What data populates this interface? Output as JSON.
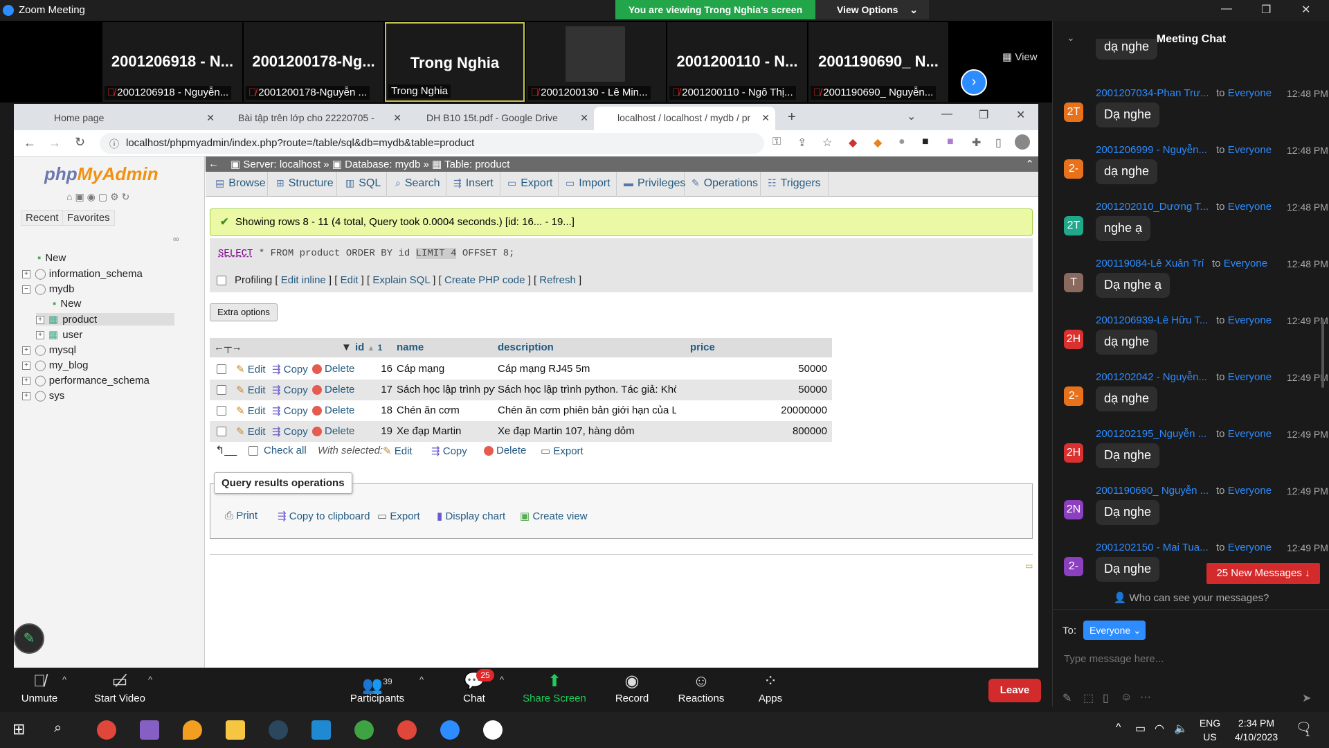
{
  "zoom": {
    "app_title": "Zoom Meeting",
    "viewing_banner": "You are viewing Trong Nghia's screen",
    "view_options": "View Options",
    "view_label": "View",
    "tiles": [
      {
        "big": "2001206918 - N...",
        "label": "2001206918 - Nguyễn..."
      },
      {
        "big": "2001200178-Ng...",
        "label": "2001200178-Nguyễn ..."
      },
      {
        "big": "Trong Nghia",
        "label": "Trong Nghia"
      },
      {
        "big": "",
        "label": "2001200130 - Lê Min..."
      },
      {
        "big": "2001200110 - N...",
        "label": "2001200110 - Ngô Thị..."
      },
      {
        "big": "2001190690_ N...",
        "label": "2001190690_ Nguyễn..."
      }
    ]
  },
  "browser": {
    "tabs": [
      {
        "title": "Home page"
      },
      {
        "title": "Bài tập trên lớp cho 22220705 - "
      },
      {
        "title": "DH B10 15t.pdf - Google Drive"
      },
      {
        "title": "localhost / localhost / mydb / pr"
      }
    ],
    "url": "localhost/phpmyadmin/index.php?route=/table/sql&db=mydb&table=product"
  },
  "pma": {
    "nav_tabs": [
      "Recent",
      "Favorites"
    ],
    "tree": [
      {
        "label": "New",
        "indent": 0
      },
      {
        "label": "information_schema",
        "indent": 0
      },
      {
        "label": "mydb",
        "indent": 0
      },
      {
        "label": "New",
        "indent": 1
      },
      {
        "label": "product",
        "indent": 1
      },
      {
        "label": "user",
        "indent": 1
      },
      {
        "label": "mysql",
        "indent": 0
      },
      {
        "label": "my_blog",
        "indent": 0
      },
      {
        "label": "performance_schema",
        "indent": 0
      },
      {
        "label": "sys",
        "indent": 0
      }
    ],
    "breadcrumb": {
      "server": "Server: localhost",
      "database": "Database: mydb",
      "table": "Table: product"
    },
    "menu": [
      "Browse",
      "Structure",
      "SQL",
      "Search",
      "Insert",
      "Export",
      "Import",
      "Privileges",
      "Operations",
      "Triggers"
    ],
    "success_message": "Showing rows 8 - 11 (4 total, Query took 0.0004 seconds.) [id: 16... - 19...]",
    "sql": {
      "select": "SELECT",
      "rest": " * FROM product ORDER BY id ",
      "limit": "LIMIT 4",
      "offset": " OFFSET 8;"
    },
    "profiling": {
      "label": "Profiling",
      "links": [
        "Edit inline",
        "Edit",
        "Explain SQL",
        "Create PHP code",
        "Refresh"
      ]
    },
    "extra_options": "Extra options",
    "columns": {
      "id": "id",
      "sort_num": "1",
      "name": "name",
      "description": "description",
      "price": "price"
    },
    "row_actions": {
      "edit": "Edit",
      "copy": "Copy",
      "delete": "Delete"
    },
    "rows": [
      {
        "id": "16",
        "name": "Cáp mạng",
        "description": "Cáp mạng RJ45 5m",
        "price": "50000"
      },
      {
        "id": "17",
        "name": "Sách học lập trình python",
        "description": "Sách học lập trình python. Tác giả: Không biết",
        "price": "50000"
      },
      {
        "id": "18",
        "name": "Chén ăn cơm",
        "description": "Chén ăn cơm phiên bản giới hạn của Luxury",
        "price": "20000000"
      },
      {
        "id": "19",
        "name": "Xe đạp Martin",
        "description": "Xe đạp Martin 107, hàng dỏm",
        "price": "800000"
      }
    ],
    "bulk": {
      "check_all": "Check all",
      "with_selected": "With selected:",
      "edit": "Edit",
      "copy": "Copy",
      "delete": "Delete",
      "export": "Export"
    },
    "qro": {
      "title": "Query results operations",
      "print": "Print",
      "copy": "Copy to clipboard",
      "export": "Export",
      "chart": "Display chart",
      "view": "Create view"
    }
  },
  "chat": {
    "title": "Meeting Chat",
    "top_partial": "dạ nghe",
    "messages": [
      {
        "initials": "2T",
        "color": "#e8711c",
        "from": "2001207034-Phan Trư...",
        "to": "Everyone",
        "time": "12:48 PM",
        "text": "Dạ nghe"
      },
      {
        "initials": "2-",
        "color": "#e8711c",
        "from": "2001206999 - Nguyễn...",
        "to": "Everyone",
        "time": "12:48 PM",
        "text": "dạ nghe"
      },
      {
        "initials": "2T",
        "color": "#1fa88a",
        "from": "2001202010_Dương T...",
        "to": "Everyone",
        "time": "12:48 PM",
        "text": "nghe ạ"
      },
      {
        "initials": "T",
        "color": "#8a6a5e",
        "from": "200119084-Lê Xuân Trí",
        "to": "Everyone",
        "time": "12:48 PM",
        "text": "Dạ nghe ạ"
      },
      {
        "initials": "2H",
        "color": "#d9312f",
        "from": "2001206939-Lê Hữu T...",
        "to": "Everyone",
        "time": "12:49 PM",
        "text": "dạ nghe"
      },
      {
        "initials": "2-",
        "color": "#e8711c",
        "from": "2001202042 - Nguyễn...",
        "to": "Everyone",
        "time": "12:49 PM",
        "text": "dạ nghe"
      },
      {
        "initials": "2H",
        "color": "#d9312f",
        "from": "2001202195_Nguyễn ...",
        "to": "Everyone",
        "time": "12:49 PM",
        "text": "Dạ nghe"
      },
      {
        "initials": "2N",
        "color": "#8c3fbf",
        "from": "2001190690_ Nguyễn ...",
        "to": "Everyone",
        "time": "12:49 PM",
        "text": "Dạ nghe"
      },
      {
        "initials": "2-",
        "color": "#8c3fbf",
        "from": "2001202150 - Mai Tua...",
        "to": "Everyone",
        "time": "12:49 PM",
        "text": "Dạ nghe"
      }
    ],
    "new_messages": "25 New Messages",
    "who_can_see": "Who can see your messages?",
    "to_label": "To:",
    "to_value": "Everyone",
    "input_placeholder": "Type message here..."
  },
  "toolbar": {
    "unmute": "Unmute",
    "start_video": "Start Video",
    "participants": "Participants",
    "participants_count": "39",
    "chat": "Chat",
    "chat_badge": "25",
    "share": "Share Screen",
    "record": "Record",
    "reactions": "Reactions",
    "apps": "Apps",
    "leave": "Leave"
  },
  "taskbar": {
    "lang_top": "ENG",
    "lang_bottom": "US",
    "time": "2:34 PM",
    "date": "4/10/2023",
    "notification_count": "1"
  }
}
